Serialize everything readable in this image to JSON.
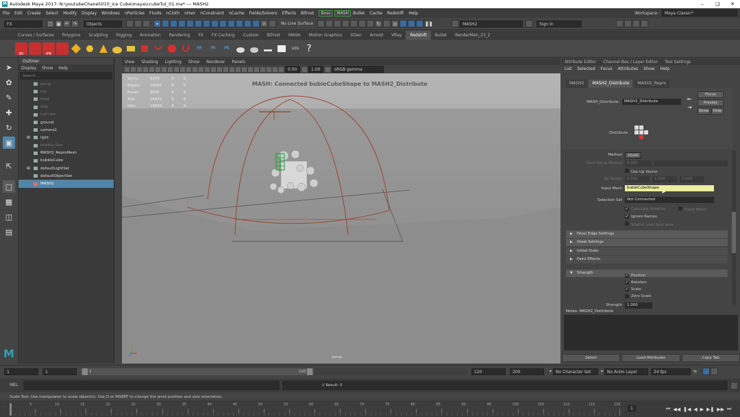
{
  "title_bar": {
    "title": "Autodesk Maya 2017: N:\\youtubeChanel\\010_ice Cube\\maya\\ccubeTut_01.ma*   ---   MASH2",
    "logo": "M"
  },
  "menu": [
    "File",
    "Edit",
    "Create",
    "Select",
    "Modify",
    "Display",
    "Windows",
    "nParticles",
    "Fluids",
    "nCloth",
    "nHair",
    "nConstraint",
    "nCache",
    "Fields/Solvers",
    "Effects",
    "Bifrost"
  ],
  "menu_boss": "Boss",
  "menu_mash": "MASH",
  "menu_tail": [
    "Bullet",
    "Cache",
    "Redshift",
    "Help"
  ],
  "workspace": {
    "label": "Workspace :",
    "value": "Maya Classic*"
  },
  "status": {
    "mode": "FX",
    "objects": "Objects",
    "live": "No Live Surface",
    "field": "MASH2",
    "signin": "Sign In"
  },
  "shelf_tabs": [
    "Curves / Surfaces",
    "Polygons",
    "Sculpting",
    "Rigging",
    "Animation",
    "Rendering",
    "FX",
    "FX Caching",
    "Custom",
    "Bifrost",
    "MASH",
    "Motion Graphics",
    "XGen",
    "Arnold",
    "VRay",
    "Redshift",
    "Bullet",
    "RenderMan_23_2"
  ],
  "shelf_active": "Redshift",
  "shelf_labels": {
    "rv": "RV",
    "ipr": "IPR",
    "pr": "PR",
    "log": "LOG"
  },
  "outliner": {
    "title": "Outliner",
    "menu": [
      "Display",
      "Show",
      "Help"
    ],
    "search": "Search...",
    "items": [
      {
        "label": "persp",
        "dim": true
      },
      {
        "label": "top",
        "dim": true
      },
      {
        "label": "front",
        "dim": true
      },
      {
        "label": "side",
        "dim": true
      },
      {
        "label": "iceCube",
        "dim": true
      },
      {
        "label": "ground",
        "dim": false
      },
      {
        "label": "camera1",
        "dim": false
      },
      {
        "label": "light",
        "dim": false
      },
      {
        "label": "bubble_Geo",
        "dim": true
      },
      {
        "label": "MASH2_ReproMesh",
        "dim": false
      },
      {
        "label": "bubbleCube",
        "dim": false
      },
      {
        "label": "defaultLightSet",
        "dim": false
      },
      {
        "label": "defaultObjectSet",
        "dim": false
      },
      {
        "label": "MASH2",
        "dim": false,
        "selected": true
      }
    ]
  },
  "viewport": {
    "menu": [
      "View",
      "Shading",
      "Lighting",
      "Show",
      "Renderer",
      "Panels"
    ],
    "exposure": "0.00",
    "gamma": "1.00",
    "colorspace": "sRGB gamma",
    "hud": [
      {
        "label": "Verts:",
        "v1": "9299",
        "v2": "0",
        "v3": "0"
      },
      {
        "label": "Edges:",
        "v1": "18092",
        "v2": "0",
        "v3": "0"
      },
      {
        "label": "Faces:",
        "v1": "8636",
        "v2": "0",
        "v3": "0"
      },
      {
        "label": "Tris:",
        "v1": "16472",
        "v2": "0",
        "v3": "0"
      },
      {
        "label": "UVs:",
        "v1": "10550",
        "v2": "0",
        "v3": "0"
      }
    ],
    "message": "MASH: Connected bubleCubeShape to MASH2_Distribute",
    "camera": "persp"
  },
  "attr": {
    "tabs": [
      "Attribute Editor",
      "Channel Box / Layer Editor",
      "Tool Settings"
    ],
    "menu": [
      "List",
      "Selected",
      "Focus",
      "Attributes",
      "Show",
      "Help"
    ],
    "node_tabs": [
      "MASH2",
      "MASH2_Distribute",
      "MASH2_Repro"
    ],
    "node_label": "MASH_Distribute:",
    "node_value": "MASH2_Distribute",
    "focus": "Focus",
    "presets": "Presets",
    "show": "Show",
    "hide": "Hide",
    "distribute": "Distribute",
    "method_label": "Method",
    "method_value": "Voxel",
    "push_label": "Push Along Normal",
    "push_value": "0.000",
    "use_up": "Use Up Vector",
    "up_label": "Up Vector",
    "up_values": [
      "0.000",
      "1.000",
      "0.000"
    ],
    "input_mesh_label": "Input Mesh",
    "input_mesh_value": "bubleCubeShape",
    "selection_label": "Selection Set",
    "selection_value": "Not Connected",
    "calc_rotation": "Calculate Rotation",
    "flood_mesh": "Flood Mesh",
    "ignore_ramps": "Ignore Ramps",
    "scatter_faces": "Scatter uses face area",
    "sections": [
      "Face/ Edge Settings",
      "Voxel Settings",
      "Initial State",
      "Paint Effects"
    ],
    "strength": "Strength",
    "strength_items": [
      {
        "label": "Position",
        "checked": true
      },
      {
        "label": "Rotation",
        "checked": true
      },
      {
        "label": "Scale",
        "checked": true
      },
      {
        "label": "Zero Scale",
        "checked": false
      }
    ],
    "strength_field_label": "Strength",
    "strength_field_value": "1.000",
    "notes": "Notes:  MASH2_Distribute",
    "buttons": [
      "Select",
      "Load Attributes",
      "Copy Tab"
    ]
  },
  "bottom": {
    "f1": "1",
    "f2": "1",
    "slider_start": "1",
    "slider_end": "120",
    "f3": "120",
    "f4": "200",
    "char_set": "No Character Set",
    "anim_layer": "No Anim Layer",
    "fps": "24 fps"
  },
  "mel": {
    "label": "MEL",
    "result": "// Result: 0"
  },
  "help": "Scale Tool: Use manipulator to scale object(s). Use D or INSERT to change the pivot position and axis orientation.",
  "timeline": {
    "ticks": [
      "5",
      "10",
      "15",
      "20",
      "25",
      "30",
      "35",
      "40",
      "45",
      "50",
      "55",
      "60",
      "65",
      "70",
      "75",
      "80",
      "85",
      "90",
      "95",
      "100",
      "105",
      "110",
      "115",
      "120"
    ],
    "current": "1"
  }
}
